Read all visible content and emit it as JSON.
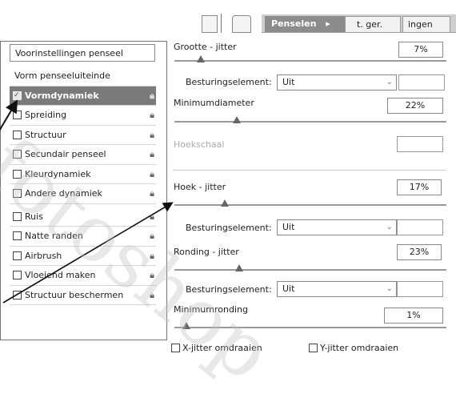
{
  "tabs": {
    "active": "Penselen",
    "tab2": "t. ger.",
    "tab3": "ingen"
  },
  "presets_label": "Voorinstellingen penseel",
  "brush_options": [
    {
      "label": "Vorm penseeluiteinde",
      "has_checkbox": false,
      "selected": false,
      "lock": false
    },
    {
      "label": "Vormdynamiek",
      "has_checkbox": true,
      "selected": true,
      "lock": true
    },
    {
      "label": "Spreiding",
      "has_checkbox": true,
      "selected": false,
      "lock": true
    },
    {
      "label": "Structuur",
      "has_checkbox": true,
      "selected": false,
      "lock": true
    },
    {
      "label": "Secundair penseel",
      "has_checkbox": true,
      "selected": false,
      "lock": true
    },
    {
      "label": "Kleurdynamiek",
      "has_checkbox": true,
      "selected": false,
      "lock": true
    },
    {
      "label": "Andere dynamiek",
      "has_checkbox": true,
      "selected": false,
      "lock": true
    },
    {
      "label": "Ruis",
      "has_checkbox": true,
      "selected": false,
      "lock": true,
      "gap_before": true
    },
    {
      "label": "Natte randen",
      "has_checkbox": true,
      "selected": false,
      "lock": true
    },
    {
      "label": "Airbrush",
      "has_checkbox": true,
      "selected": false,
      "lock": true
    },
    {
      "label": "Vloeiend maken",
      "has_checkbox": true,
      "selected": false,
      "lock": true
    },
    {
      "label": "Structuur beschermen",
      "has_checkbox": true,
      "selected": false,
      "lock": true
    }
  ],
  "settings": {
    "size_jitter": {
      "label": "Grootte - jitter",
      "value": "7%",
      "level": 0.07
    },
    "control1": {
      "label": "Besturingselement:",
      "value": "Uit"
    },
    "min_diameter": {
      "label": "Minimumdiameter",
      "value": "22%",
      "level": 0.22
    },
    "tilt_scale": {
      "label": "Hoekschaal"
    },
    "angle_jitter": {
      "label": "Hoek - jitter",
      "value": "17%",
      "level": 0.17
    },
    "control2": {
      "label": "Besturingselement:",
      "value": "Uit"
    },
    "roundness_jitter": {
      "label": "Ronding - jitter",
      "value": "23%",
      "level": 0.23
    },
    "control3": {
      "label": "Besturingselement:",
      "value": "Uit"
    },
    "min_roundness": {
      "label": "Minimumronding",
      "value": "1%",
      "level": 0.01
    }
  },
  "flip_x": "X-jitter omdraaien",
  "flip_y": "Y-jitter omdraaien",
  "watermark": "fotoshop"
}
